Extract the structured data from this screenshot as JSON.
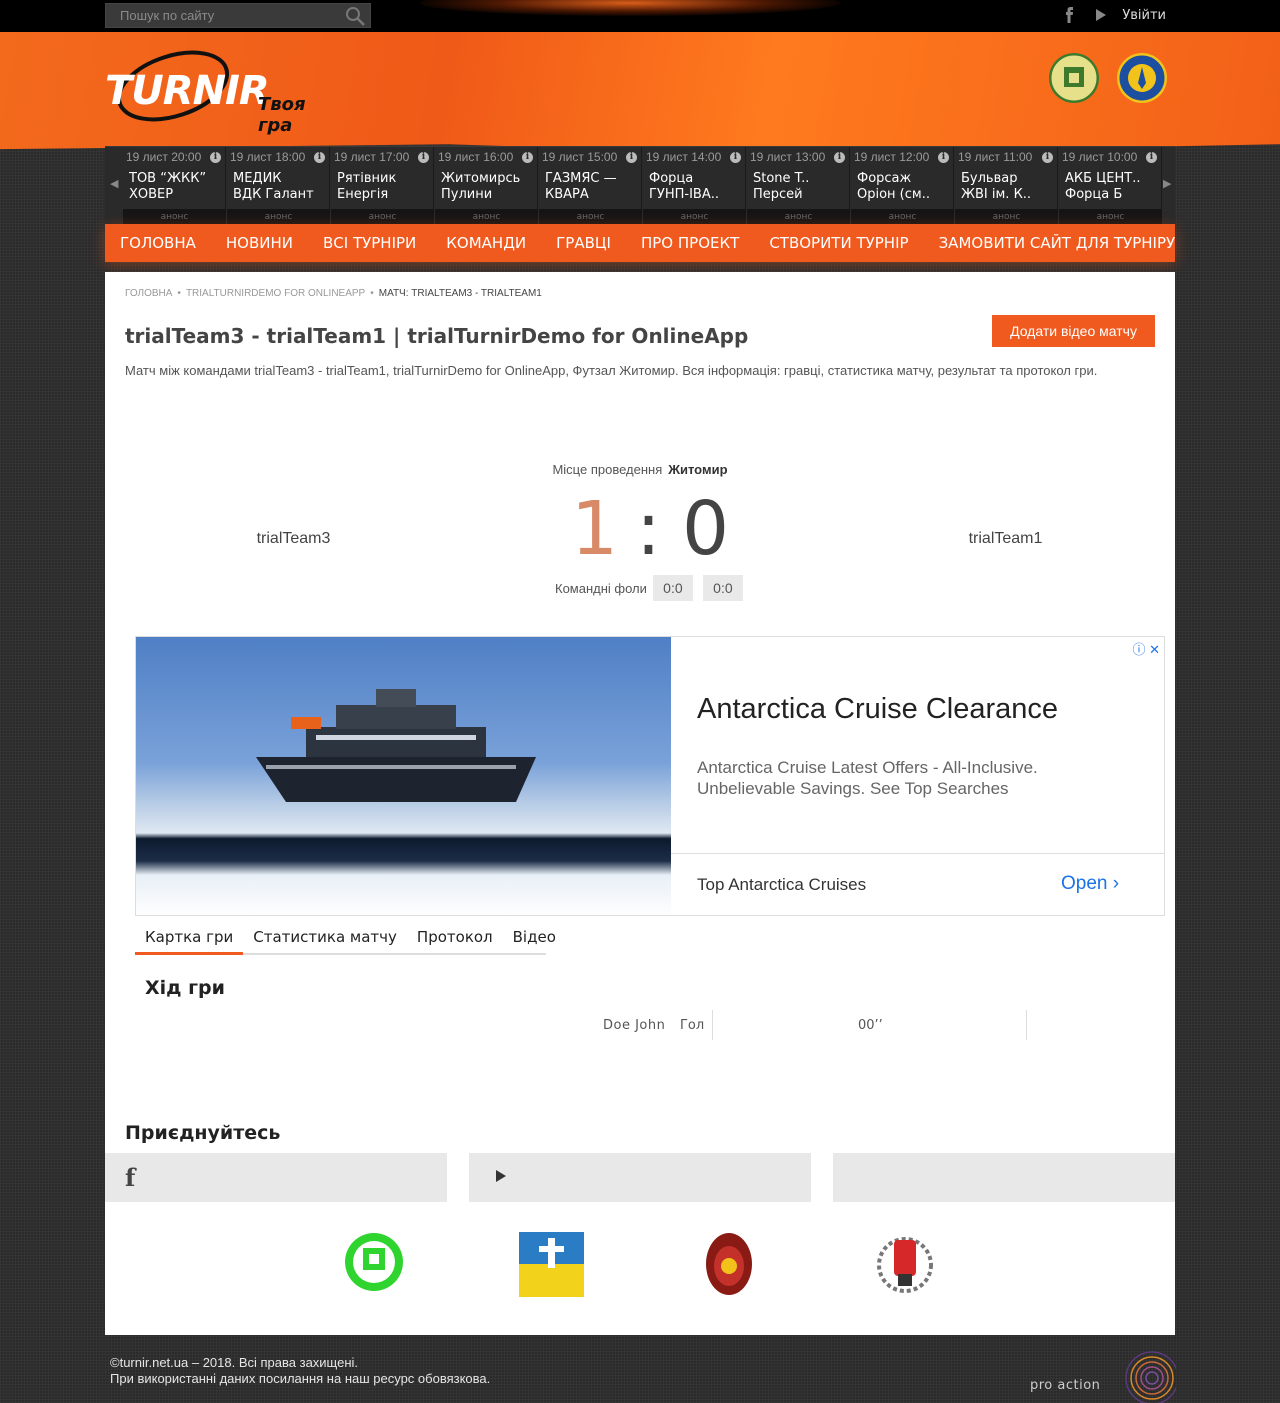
{
  "topbar": {
    "search_placeholder": "Пошук по сайту",
    "login_label": "Увійти",
    "social_icons": [
      "facebook-icon",
      "youtube-icon"
    ]
  },
  "header": {
    "brand": "TURNIR",
    "slogan": "Твоя гра",
    "partner_logos": [
      "zhytomyr-futsal-association-logo",
      "ukraine-futsal-association-logo"
    ]
  },
  "ticker": {
    "info_glyph": "i",
    "matches": [
      {
        "time": "19 лист 20:00",
        "home": "ТОВ “ЖКК”",
        "away": "ХОВЕР",
        "status": "анонс"
      },
      {
        "time": "19 лист 18:00",
        "home": "МЕДИК",
        "away": "ВДК Галант",
        "status": "анонс"
      },
      {
        "time": "19 лист 17:00",
        "home": "Рятівник",
        "away": "Енергія",
        "status": "анонс"
      },
      {
        "time": "19 лист 16:00",
        "home": "Житомирсь",
        "away": "Пулини",
        "status": "анонс"
      },
      {
        "time": "19 лист 15:00",
        "home": "ГАЗМЯС —",
        "away": "КВАРА",
        "status": "анонс"
      },
      {
        "time": "19 лист 14:00",
        "home": "Форца",
        "away": "ГУНП-ІВА..",
        "status": "анонс"
      },
      {
        "time": "19 лист 13:00",
        "home": "Stone T..",
        "away": "Персей",
        "status": "анонс"
      },
      {
        "time": "19 лист 12:00",
        "home": "Форсаж",
        "away": "Оріон (см..",
        "status": "анонс"
      },
      {
        "time": "19 лист 11:00",
        "home": "Бульвар",
        "away": "ЖВІ ім. К..",
        "status": "анонс"
      },
      {
        "time": "19 лист 10:00",
        "home": "АКБ ЦЕНТ..",
        "away": "Форца Б",
        "status": "анонс"
      }
    ]
  },
  "nav": {
    "items": [
      "ГОЛОВНА",
      "НОВИНИ",
      "ВСІ ТУРНІРИ",
      "КОМАНДИ",
      "ГРАВЦІ",
      "ПРО ПРОЕКТ",
      "СТВОРИТИ ТУРНІР",
      "ЗАМОВИТИ САЙТ ДЛЯ ТУРНІРУ"
    ]
  },
  "breadcrumb": {
    "items": [
      "Головна",
      "trialTurnirDemo for OnlineApp",
      "Матч: trialTeam3 - trialTeam1"
    ],
    "separator": "•"
  },
  "page": {
    "title": "trialTeam3 - trialTeam1 | trialTurnirDemo for OnlineApp",
    "add_video_label": "Додати відео матчу",
    "description": "Матч між командами trialTeam3 - trialTeam1, trialTurnirDemo for OnlineApp, Футзал Житомир. Вся інформація: гравці, статистика матчу, результат та протокол гри."
  },
  "match": {
    "venue_label": "Місце проведення",
    "venue": "Житомир",
    "home_team": "trialTeam3",
    "away_team": "trialTeam1",
    "home_score": "1",
    "separator": ":",
    "away_score": "0",
    "fouls_label": "Командні фоли",
    "home_fouls": "0:0",
    "away_fouls": "0:0"
  },
  "ad": {
    "headline": "Antarctica Cruise Clearance",
    "body": "Antarctica Cruise Latest Offers - All-Inclusive. Unbelievable Savings. See Top Searches",
    "bottom_text": "Top Antarctica Cruises",
    "cta": "Open",
    "adchoice_glyphs": "ⓘ ✕"
  },
  "tabs": [
    "Картка гри",
    "Статистика матчу",
    "Протокол",
    "Відео"
  ],
  "game_flow": {
    "title": "Хід гри",
    "events": [
      {
        "player": "Doe John",
        "type": "Гол",
        "minute": "00’’"
      }
    ]
  },
  "join": {
    "title": "Приєднуйтесь",
    "social_icons": [
      "facebook-icon",
      "youtube-icon",
      ""
    ]
  },
  "partners": [
    "zhytomyr-futsal-logo",
    "christian-football-league-logo",
    "fortuna-logo",
    "fist-emblem-logo"
  ],
  "footer": {
    "copyright": "©turnir.net.ua – 2018. Всі права захищені.",
    "notice": "При використанні даних посилання на наш ресурс обовязкова.",
    "developer": "pro action"
  },
  "colors": {
    "accent": "#f05a1e",
    "header_orange": "#f36a1c",
    "home_score": "#d88a66",
    "ad_link": "#1a73e8"
  }
}
